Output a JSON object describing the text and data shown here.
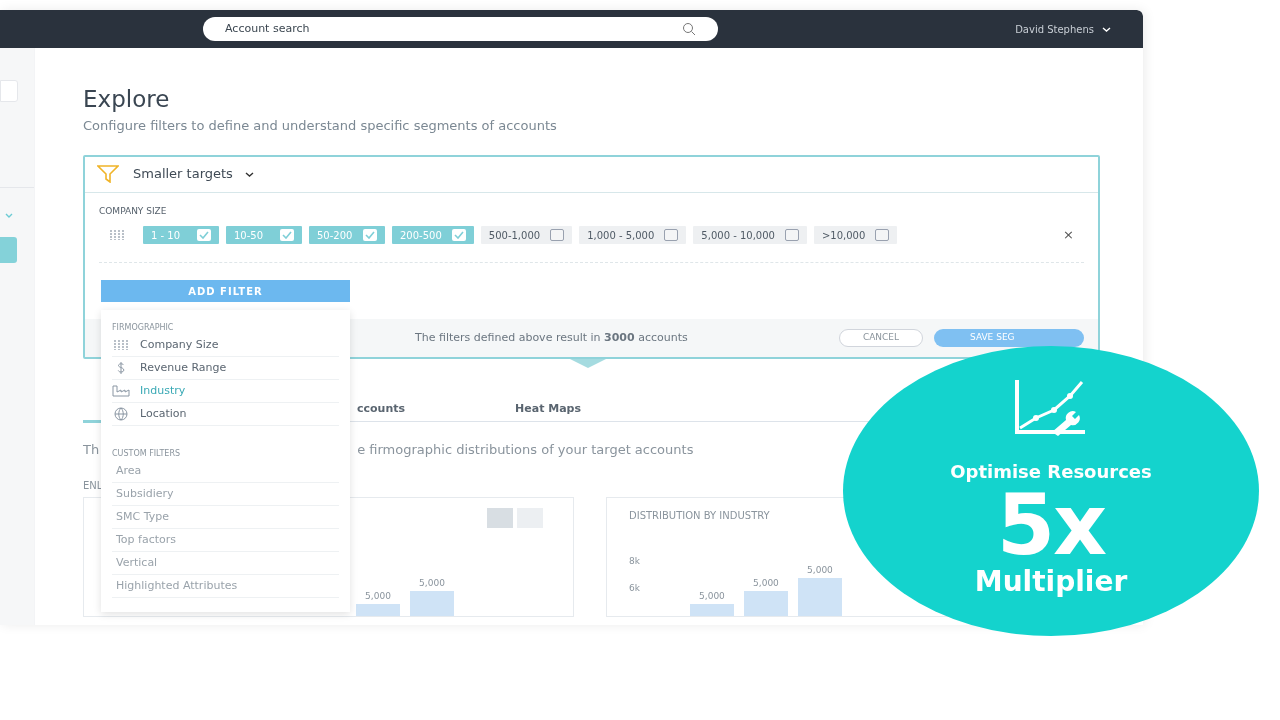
{
  "topbar": {
    "search": {
      "placeholder": "Account search"
    },
    "user": "David Stephens"
  },
  "page": {
    "title": "Explore",
    "subtitle": "Configure filters to define and understand specific segments of accounts"
  },
  "filter_card": {
    "segment": "Smaller targets",
    "section_label": "COMPANY SIZE",
    "chips": [
      {
        "label": "1 - 10",
        "checked": true
      },
      {
        "label": "10-50",
        "checked": true
      },
      {
        "label": "50-200",
        "checked": true
      },
      {
        "label": "200-500",
        "checked": true
      },
      {
        "label": "500-1,000",
        "checked": false
      },
      {
        "label": "1,000 - 5,000",
        "checked": false
      },
      {
        "label": "5,000 - 10,000",
        "checked": false
      },
      {
        "label": ">10,000",
        "checked": false
      }
    ],
    "remove": "×",
    "add_filter": "ADD FILTER",
    "result": "The filters defined above result in **3000** accounts",
    "cancel": "CANCEL",
    "save": "SAVE SEG"
  },
  "dropdown": {
    "groups": [
      {
        "heading": "FIRMOGRAPHIC",
        "items": [
          {
            "label": "Company Size",
            "kind": "size",
            "selected": false
          },
          {
            "label": "Revenue Range",
            "kind": "dollar",
            "selected": false
          },
          {
            "label": "Industry",
            "kind": "industry",
            "selected": true
          },
          {
            "label": "Location",
            "kind": "globe",
            "selected": false
          }
        ]
      },
      {
        "heading": "CUSTOM FILTERS",
        "items": [
          {
            "label": "Area",
            "kind": "plain",
            "selected": false
          },
          {
            "label": "Subsidiery",
            "kind": "plain",
            "selected": false
          },
          {
            "label": "SMC Type",
            "kind": "plain",
            "selected": false
          },
          {
            "label": "Top factors",
            "kind": "plain",
            "selected": false
          },
          {
            "label": "Vertical",
            "kind": "plain",
            "selected": false
          },
          {
            "label": "Highlighted Attributes",
            "kind": "plain",
            "selected": false
          }
        ]
      }
    ]
  },
  "tabs": [
    {
      "label": "ccounts",
      "selected": false
    },
    {
      "label": "Heat Maps",
      "selected": false
    }
  ],
  "description": {
    "part_1": "Th",
    "part_2": "e firmographic distributions of your target accounts"
  },
  "section_label": "ENL",
  "charts": [
    {
      "bar_labels": [
        "5,000",
        "5,000"
      ]
    },
    {
      "title": "DISTRIBUTION BY INDUSTRY",
      "axis_labels": [
        "8k",
        "6k"
      ],
      "bar_labels": [
        "5,000",
        "5,000",
        "5,000"
      ]
    }
  ],
  "promo": {
    "headline": "Optimise Resources",
    "figure": "5x",
    "caption": "Multiplier"
  }
}
